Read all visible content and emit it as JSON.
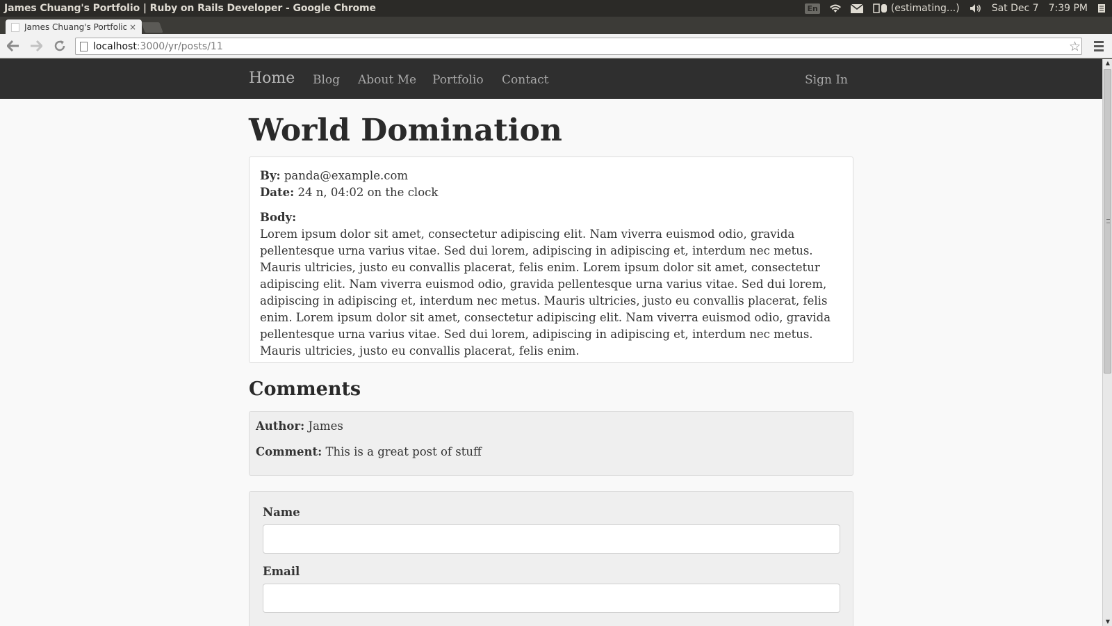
{
  "os_bar": {
    "window_title": "James Chuang's Portfolio | Ruby on Rails Developer - Google Chrome",
    "language": "En",
    "battery": "(estimating...)",
    "date": "Sat Dec 7",
    "time": "7:39 PM",
    "icons": [
      "keyboard-icon",
      "wifi-icon",
      "mail-icon",
      "battery-icon",
      "volume-icon",
      "session-icon"
    ]
  },
  "browser": {
    "tab_title": "James Chuang's Portfolio",
    "tab_close": "×",
    "url_host": "localhost",
    "url_rest": ":3000/yr/posts/11"
  },
  "site_nav": {
    "brand": "Home",
    "links": [
      "Blog",
      "About Me",
      "Portfolio",
      "Contact"
    ],
    "sign_in": "Sign In"
  },
  "post": {
    "title": "World Domination",
    "by_label": "By:",
    "by_value": "panda@example.com",
    "date_label": "Date:",
    "date_value": "24 n, 04:02 on the clock",
    "body_label": "Body:",
    "body": "Lorem ipsum dolor sit amet, consectetur adipiscing elit. Nam viverra euismod odio, gravida pellentesque urna varius vitae. Sed dui lorem, adipiscing in adipiscing et, interdum nec metus. Mauris ultricies, justo eu convallis placerat, felis enim. Lorem ipsum dolor sit amet, consectetur adipiscing elit. Nam viverra euismod odio, gravida pellentesque urna varius vitae. Sed dui lorem, adipiscing in adipiscing et, interdum nec metus. Mauris ultricies, justo eu convallis placerat, felis enim. Lorem ipsum dolor sit amet, consectetur adipiscing elit. Nam viverra euismod odio, gravida pellentesque urna varius vitae. Sed dui lorem, adipiscing in adipiscing et, interdum nec metus. Mauris ultricies, justo eu convallis placerat, felis enim."
  },
  "comments": {
    "heading": "Comments",
    "items": [
      {
        "author_label": "Author:",
        "author": "James",
        "comment_label": "Comment:",
        "comment": "This is a great post of stuff"
      }
    ]
  },
  "comment_form": {
    "name_label": "Name",
    "name_value": "",
    "email_label": "Email",
    "email_value": ""
  }
}
